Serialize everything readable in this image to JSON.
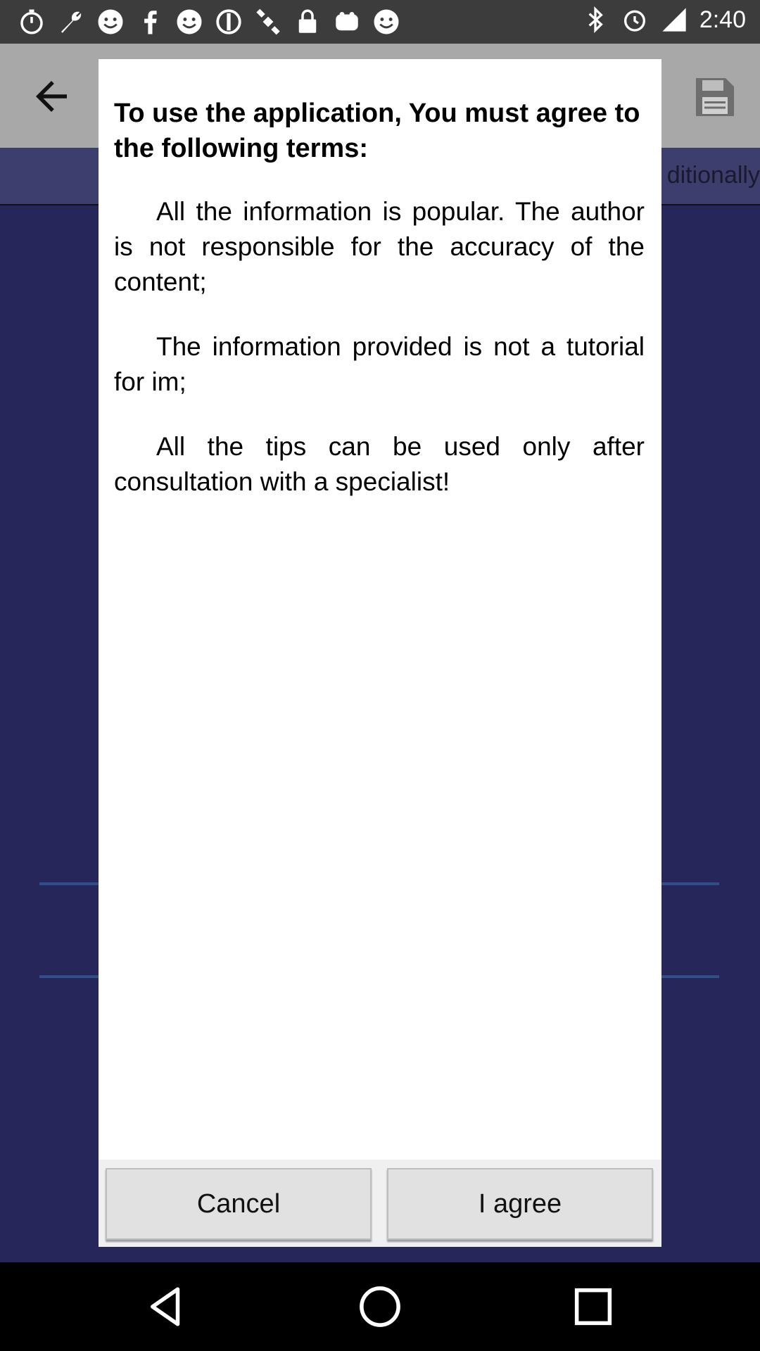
{
  "status_bar": {
    "time": "2:40",
    "left_icons": [
      "timer-icon",
      "wrench-icon",
      "smiley-icon",
      "facebook-icon",
      "smiley-icon",
      "smiley-icon",
      "blocked-icon",
      "satellite-icon",
      "lock-icon",
      "cup-icon",
      "smiley-icon",
      "bluetooth-icon",
      "alarm-icon",
      "signal-icon"
    ]
  },
  "app_bar": {
    "subtab_text": "ditionally"
  },
  "dialog": {
    "title": "To use the application, You must agree to the following terms:",
    "terms": [
      "All the information is popular. The author is not responsible for the accuracy of the content;",
      "The information provided is not a tutorial for im;",
      "All the tips can be used only after consultation with a specialist!"
    ],
    "cancel_label": "Cancel",
    "agree_label": "I agree"
  },
  "colors": {
    "overlay_background": "#26265b",
    "app_bar": "#a8a8a8",
    "status_bar": "#3c3c3c",
    "button_face": "#e1e1e1"
  }
}
